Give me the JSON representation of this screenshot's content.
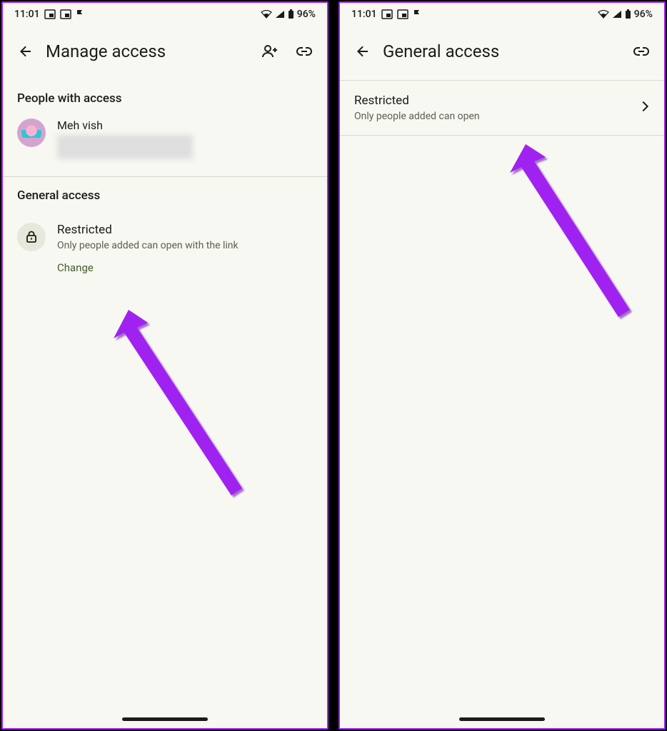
{
  "status": {
    "time": "11:01",
    "battery": "96%"
  },
  "left": {
    "title": "Manage access",
    "section_people": "People with access",
    "person_name": "Meh vish",
    "section_general": "General access",
    "general_title": "Restricted",
    "general_sub": "Only people added can open with the link",
    "change": "Change"
  },
  "right": {
    "title": "General access",
    "item_title": "Restricted",
    "item_sub": "Only people added can open"
  }
}
